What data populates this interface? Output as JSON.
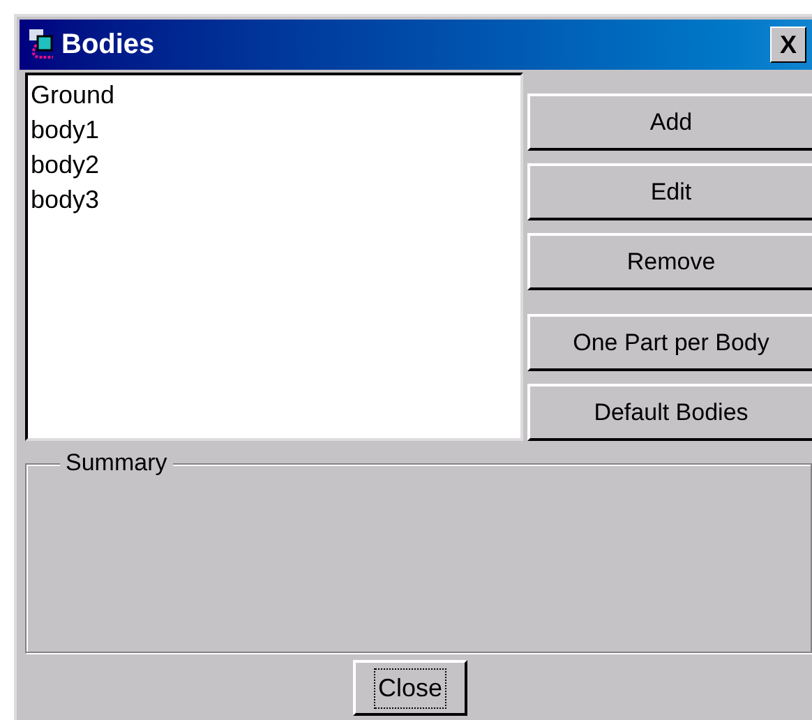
{
  "window": {
    "title": "Bodies",
    "close_glyph": "X"
  },
  "bodies": [
    {
      "name": "Ground"
    },
    {
      "name": "body1"
    },
    {
      "name": "body2"
    },
    {
      "name": "body3"
    }
  ],
  "buttons": [
    {
      "label": "Add"
    },
    {
      "label": "Edit"
    },
    {
      "label": "Remove"
    },
    {
      "label": "One Part per Body"
    },
    {
      "label": "Default Bodies"
    }
  ],
  "summary": {
    "label": "Summary"
  },
  "footer_button": {
    "label": "Close",
    "focused": true
  }
}
